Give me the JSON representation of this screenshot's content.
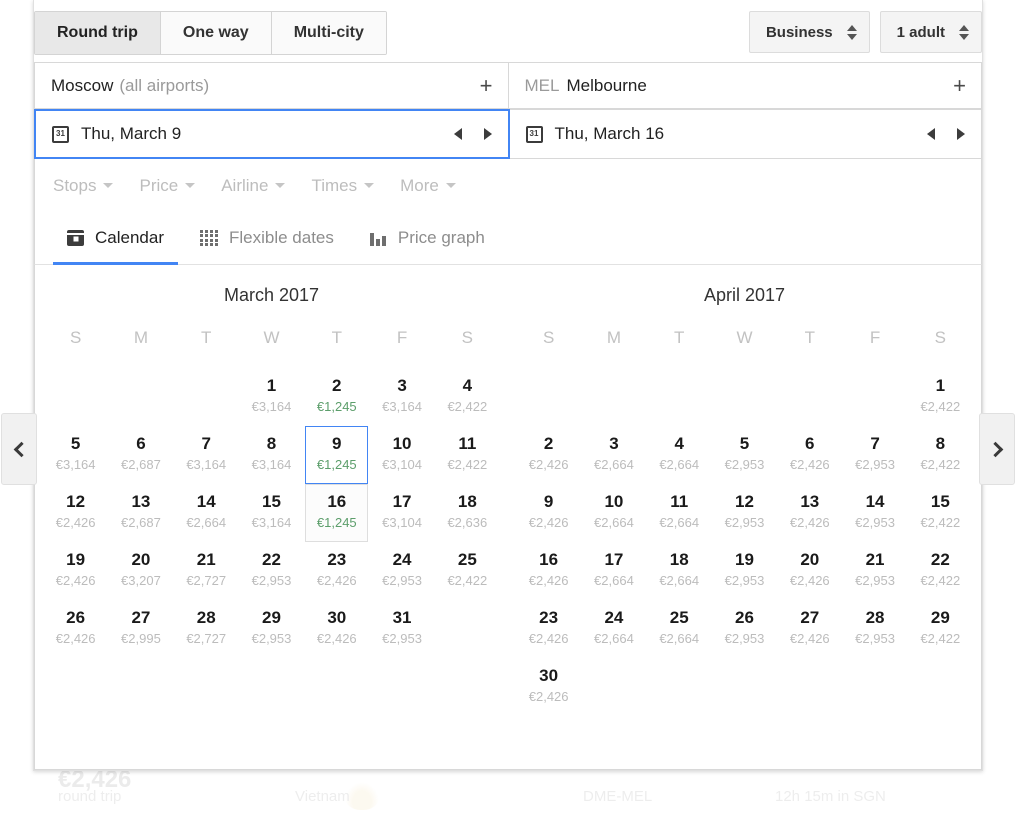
{
  "search": {
    "trip_types": [
      {
        "label": "Round trip",
        "selected": true
      },
      {
        "label": "One way",
        "selected": false
      },
      {
        "label": "Multi-city",
        "selected": false
      }
    ],
    "cabin_class": "Business",
    "passengers": "1 adult",
    "origin": {
      "code": "",
      "name": "Moscow",
      "sub": "(all airports)"
    },
    "destination": {
      "code": "MEL",
      "name": "Melbourne",
      "sub": ""
    },
    "depart_date": "Thu, March 9",
    "return_date": "Thu, March 16",
    "add_icon": "+",
    "calendar_badge": "31"
  },
  "filters": [
    {
      "label": "Stops"
    },
    {
      "label": "Price"
    },
    {
      "label": "Airline"
    },
    {
      "label": "Times"
    },
    {
      "label": "More"
    }
  ],
  "view_tabs": [
    {
      "label": "Calendar",
      "icon": "calendar-icon",
      "active": true
    },
    {
      "label": "Flexible dates",
      "icon": "grid-icon",
      "active": false
    },
    {
      "label": "Price graph",
      "icon": "bar-chart-icon",
      "active": false
    }
  ],
  "calendar": {
    "weekdays": [
      "S",
      "M",
      "T",
      "W",
      "T",
      "F",
      "S"
    ],
    "prev_label": "‹",
    "next_label": "›",
    "months": [
      {
        "title": "March 2017",
        "lead_blanks": 3,
        "days": [
          {
            "n": "1",
            "price": "€3,164"
          },
          {
            "n": "2",
            "price": "€1,245",
            "cheap": true
          },
          {
            "n": "3",
            "price": "€3,164"
          },
          {
            "n": "4",
            "price": "€2,422"
          },
          {
            "n": "5",
            "price": "€3,164"
          },
          {
            "n": "6",
            "price": "€2,687"
          },
          {
            "n": "7",
            "price": "€3,164"
          },
          {
            "n": "8",
            "price": "€3,164"
          },
          {
            "n": "9",
            "price": "€1,245",
            "cheap": true,
            "state": "depart"
          },
          {
            "n": "10",
            "price": "€3,104"
          },
          {
            "n": "11",
            "price": "€2,422"
          },
          {
            "n": "12",
            "price": "€2,426"
          },
          {
            "n": "13",
            "price": "€2,687"
          },
          {
            "n": "14",
            "price": "€2,664"
          },
          {
            "n": "15",
            "price": "€3,164"
          },
          {
            "n": "16",
            "price": "€1,245",
            "cheap": true,
            "state": "return"
          },
          {
            "n": "17",
            "price": "€3,104"
          },
          {
            "n": "18",
            "price": "€2,636"
          },
          {
            "n": "19",
            "price": "€2,426"
          },
          {
            "n": "20",
            "price": "€3,207"
          },
          {
            "n": "21",
            "price": "€2,727"
          },
          {
            "n": "22",
            "price": "€2,953"
          },
          {
            "n": "23",
            "price": "€2,426"
          },
          {
            "n": "24",
            "price": "€2,953"
          },
          {
            "n": "25",
            "price": "€2,422"
          },
          {
            "n": "26",
            "price": "€2,426"
          },
          {
            "n": "27",
            "price": "€2,995"
          },
          {
            "n": "28",
            "price": "€2,727"
          },
          {
            "n": "29",
            "price": "€2,953"
          },
          {
            "n": "30",
            "price": "€2,426"
          },
          {
            "n": "31",
            "price": "€2,953"
          }
        ]
      },
      {
        "title": "April 2017",
        "lead_blanks": 6,
        "days": [
          {
            "n": "1",
            "price": "€2,422"
          },
          {
            "n": "2",
            "price": "€2,426"
          },
          {
            "n": "3",
            "price": "€2,664"
          },
          {
            "n": "4",
            "price": "€2,664"
          },
          {
            "n": "5",
            "price": "€2,953"
          },
          {
            "n": "6",
            "price": "€2,426"
          },
          {
            "n": "7",
            "price": "€2,953"
          },
          {
            "n": "8",
            "price": "€2,422"
          },
          {
            "n": "9",
            "price": "€2,426"
          },
          {
            "n": "10",
            "price": "€2,664"
          },
          {
            "n": "11",
            "price": "€2,664"
          },
          {
            "n": "12",
            "price": "€2,953"
          },
          {
            "n": "13",
            "price": "€2,426"
          },
          {
            "n": "14",
            "price": "€2,953"
          },
          {
            "n": "15",
            "price": "€2,422"
          },
          {
            "n": "16",
            "price": "€2,426"
          },
          {
            "n": "17",
            "price": "€2,664"
          },
          {
            "n": "18",
            "price": "€2,664"
          },
          {
            "n": "19",
            "price": "€2,953"
          },
          {
            "n": "20",
            "price": "€2,426"
          },
          {
            "n": "21",
            "price": "€2,953"
          },
          {
            "n": "22",
            "price": "€2,422"
          },
          {
            "n": "23",
            "price": "€2,426"
          },
          {
            "n": "24",
            "price": "€2,664"
          },
          {
            "n": "25",
            "price": "€2,664"
          },
          {
            "n": "26",
            "price": "€2,953"
          },
          {
            "n": "27",
            "price": "€2,426"
          },
          {
            "n": "28",
            "price": "€2,953"
          },
          {
            "n": "29",
            "price": "€2,422"
          },
          {
            "n": "30",
            "price": "€2,426"
          }
        ]
      }
    ]
  },
  "background_results": {
    "price": "€2,426",
    "trip_type": "round trip",
    "airline": "Vietnam",
    "route": "DME-MEL",
    "layover": "12h 15m in SGN"
  },
  "colors": {
    "accent_blue": "#4285f4",
    "cheap_green": "#5c9e6b",
    "muted_gray": "#bcbcbc"
  }
}
